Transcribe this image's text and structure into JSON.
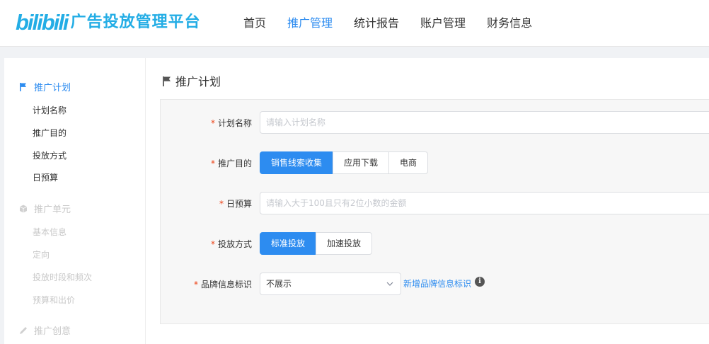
{
  "header": {
    "logo_mark": "bilibili",
    "logo_text": "广告投放管理平台",
    "nav": [
      {
        "label": "首页",
        "active": false
      },
      {
        "label": "推广管理",
        "active": true
      },
      {
        "label": "统计报告",
        "active": false
      },
      {
        "label": "账户管理",
        "active": false
      },
      {
        "label": "财务信息",
        "active": false
      }
    ]
  },
  "sidebar": {
    "sections": [
      {
        "title": "推广计划",
        "icon": "flag-icon",
        "state": "active",
        "items": [
          "计划名称",
          "推广目的",
          "投放方式",
          "日预算"
        ]
      },
      {
        "title": "推广单元",
        "icon": "cube-icon",
        "state": "disabled",
        "items": [
          "基本信息",
          "定向",
          "投放时段和频次",
          "预算和出价"
        ]
      },
      {
        "title": "推广创意",
        "icon": "pen-icon",
        "state": "disabled",
        "items": []
      }
    ]
  },
  "content": {
    "title": "推广计划",
    "form": {
      "plan_name": {
        "label": "计划名称",
        "placeholder": "请输入计划名称"
      },
      "purpose": {
        "label": "推广目的",
        "options": [
          "销售线索收集",
          "应用下载",
          "电商"
        ],
        "selected": "销售线索收集"
      },
      "budget": {
        "label": "日预算",
        "placeholder": "请输入大于100且只有2位小数的金额"
      },
      "delivery": {
        "label": "投放方式",
        "options": [
          "标准投放",
          "加速投放"
        ],
        "selected": "标准投放"
      },
      "brand": {
        "label": "品牌信息标识",
        "value": "不展示",
        "link": "新增品牌信息标识",
        "info": "i"
      }
    }
  },
  "colors": {
    "brand": "#23ade5",
    "primary": "#2d8cf0",
    "required": "#ed4014",
    "disabled": "#c8c8c8"
  }
}
